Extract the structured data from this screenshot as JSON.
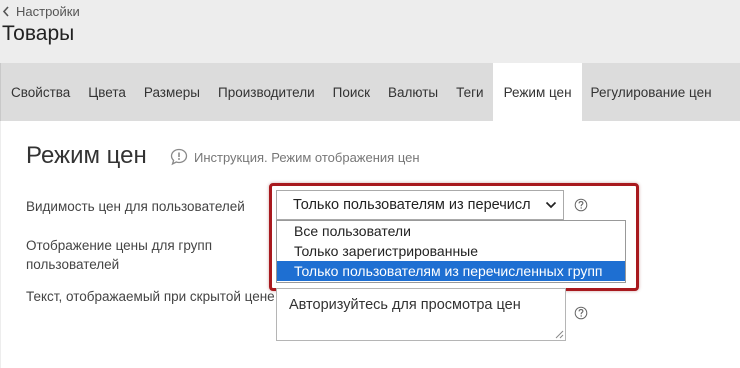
{
  "breadcrumb": {
    "label": "Настройки",
    "icon": "chevron-left-icon"
  },
  "page": {
    "title": "Товары"
  },
  "tabs": [
    {
      "label": "Свойства",
      "active": false
    },
    {
      "label": "Цвета",
      "active": false
    },
    {
      "label": "Размеры",
      "active": false
    },
    {
      "label": "Производители",
      "active": false
    },
    {
      "label": "Поиск",
      "active": false
    },
    {
      "label": "Валюты",
      "active": false
    },
    {
      "label": "Теги",
      "active": false
    },
    {
      "label": "Режим цен",
      "active": true
    },
    {
      "label": "Регулирование цен",
      "active": false
    }
  ],
  "section": {
    "title": "Режим цен",
    "instruction": "Инструкция. Режим отображения цен",
    "instruction_icon": "comment-info-icon"
  },
  "form": {
    "visibility": {
      "label": "Видимость цен для пользователей",
      "selected_display": "Только пользователям из перечисл",
      "options": [
        "Все пользователи",
        "Только зарегистрированные",
        "Только пользователям из перечисленных групп"
      ],
      "highlighted_index": 2
    },
    "groups_label": "Отображение цены для групп пользователей",
    "hidden_text": {
      "label": "Текст, отображаемый при скрытой цене",
      "value": "Авторизуйтесь для просмотра цен"
    }
  },
  "colors": {
    "tabs_bg": "#dcdcdc",
    "page_bg": "#ededed",
    "highlight_frame": "#a8191e",
    "option_selected": "#1e6fd2"
  }
}
